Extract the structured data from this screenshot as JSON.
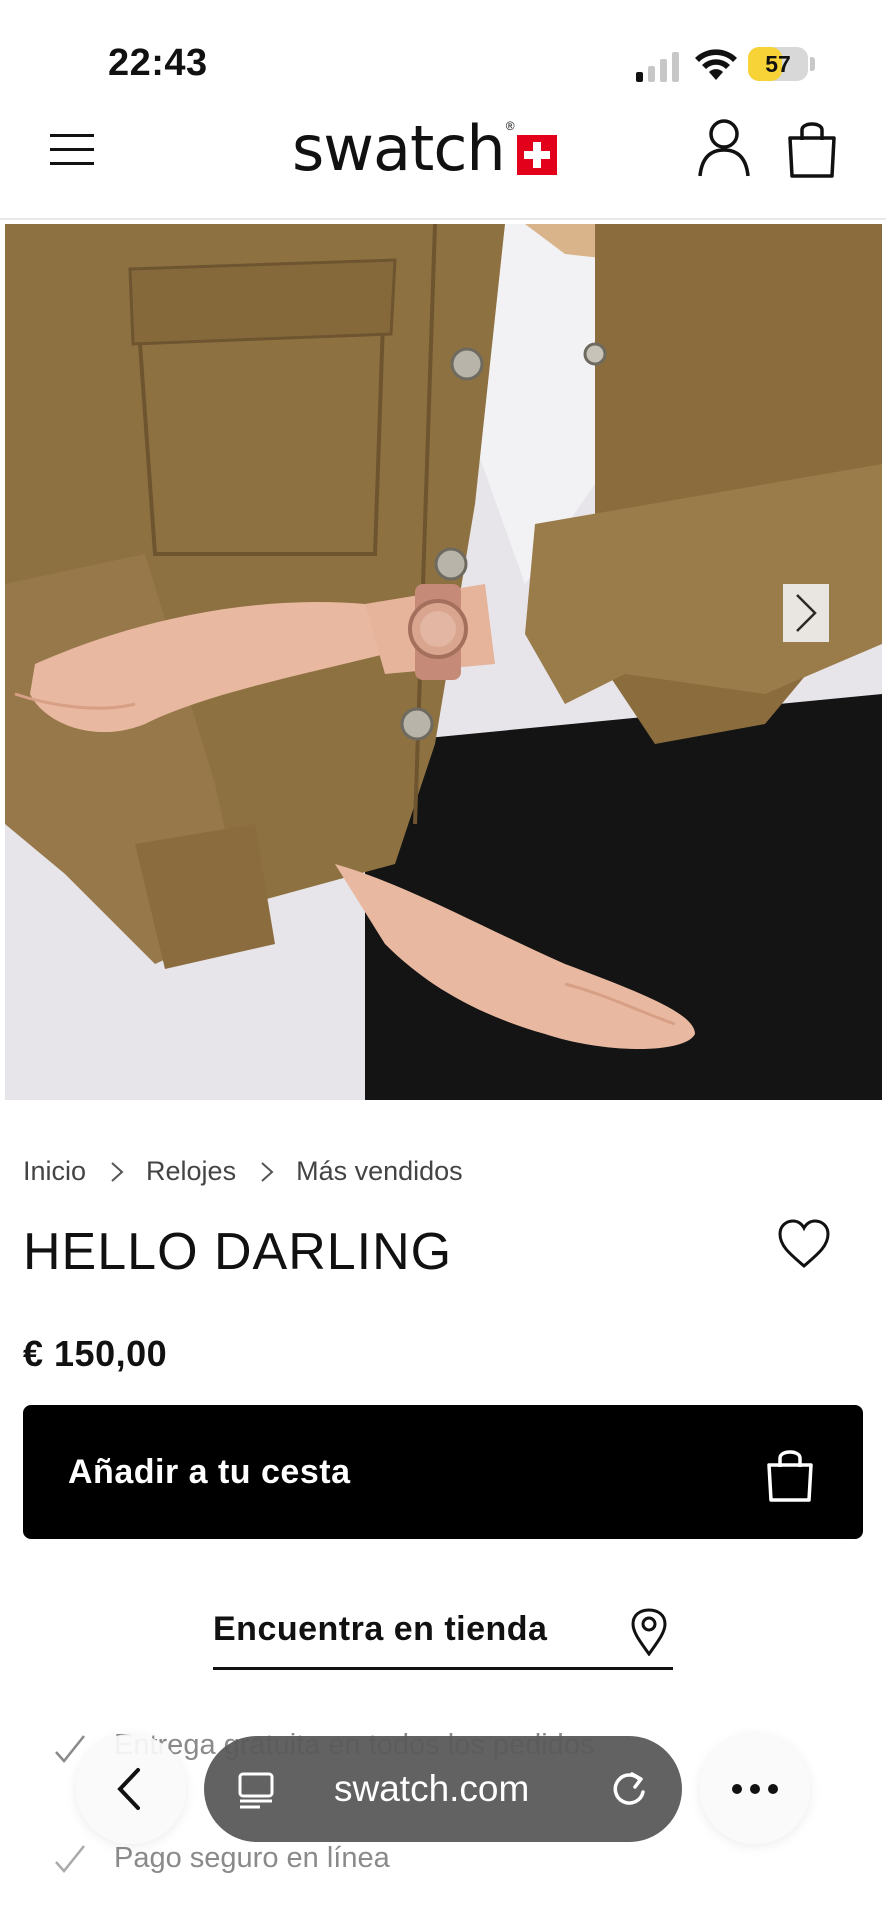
{
  "status_bar": {
    "time": "22:43",
    "battery": "57",
    "battery_level": 0.57,
    "battery_color": "#f7d338"
  },
  "header": {
    "logo_text": "swatch",
    "logo_reg": "®",
    "brand_red": "#e2001a",
    "icons": [
      "hamburger-menu-icon",
      "user-account-icon",
      "shopping-bag-icon"
    ]
  },
  "gallery": {
    "image_alt": "Model wearing rose-gold watch with olive denim jacket",
    "next_icon": "chevron-right-icon"
  },
  "breadcrumb": {
    "items": [
      "Inicio",
      "Relojes",
      "Más vendidos"
    ]
  },
  "product": {
    "title": "HELLO DARLING",
    "price": "€ 150,00",
    "wishlist_icon": "heart-icon"
  },
  "actions": {
    "add_to_cart": "Añadir a tu cesta",
    "find_in_store": "Encuentra en tienda"
  },
  "features": [
    "Entrega gratuita en todos los pedidos",
    "Pago seguro en línea"
  ],
  "browser": {
    "url": "swatch.com",
    "back_icon": "chevron-left-icon",
    "more_icon": "ellipsis-icon",
    "tabs_icon": "tabs-icon",
    "reload_icon": "reload-icon"
  }
}
